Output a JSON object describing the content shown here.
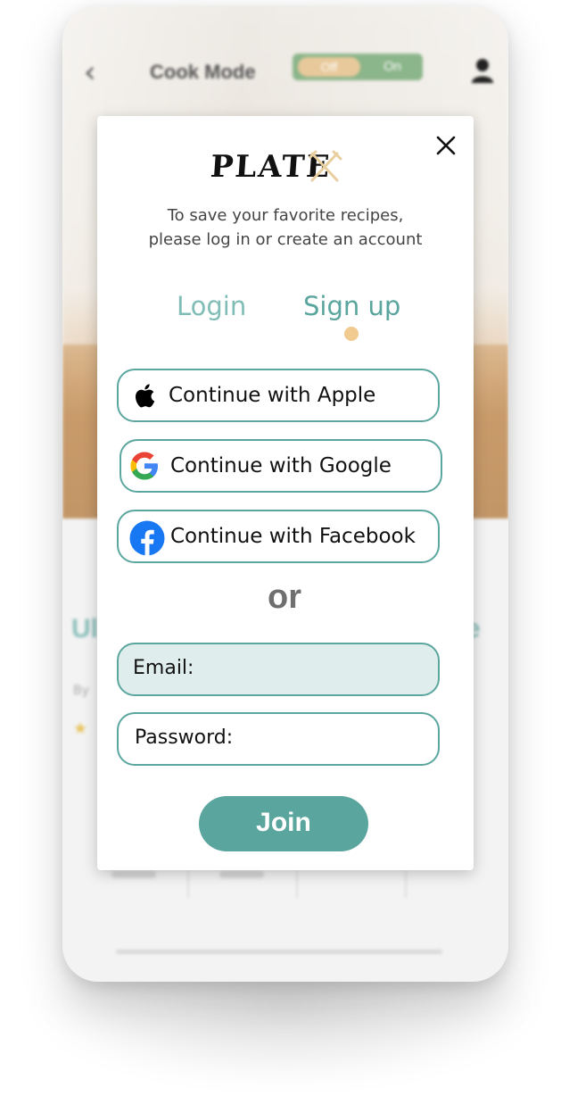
{
  "background_app": {
    "header": {
      "title": "Cook Mode",
      "toggle_off_label": "Off",
      "toggle_on_label": "On"
    },
    "icons": {
      "back": "chevron-left-icon",
      "profile": "user-icon"
    }
  },
  "modal": {
    "brand": "PLATE",
    "subtitle_line1": "To save your favorite recipes,",
    "subtitle_line2": "please log in or create an account",
    "tabs": [
      {
        "label": "Login",
        "active": false
      },
      {
        "label": "Sign up",
        "active": true
      }
    ],
    "social_buttons": [
      {
        "label": "Continue with Apple",
        "icon": "apple-icon"
      },
      {
        "label": "Continue with Google",
        "icon": "google-icon"
      },
      {
        "label": "Continue with Facebook",
        "icon": "facebook-icon"
      }
    ],
    "divider_text": "or",
    "fields": {
      "email_label": "Email:",
      "password_label": "Password:"
    },
    "submit_label": "Join"
  },
  "colors": {
    "accent": "#5aa59d",
    "accent_light": "#80bdb6",
    "tab_indicator": "#f0ca8f",
    "email_field_bg": "#dfeeec"
  }
}
